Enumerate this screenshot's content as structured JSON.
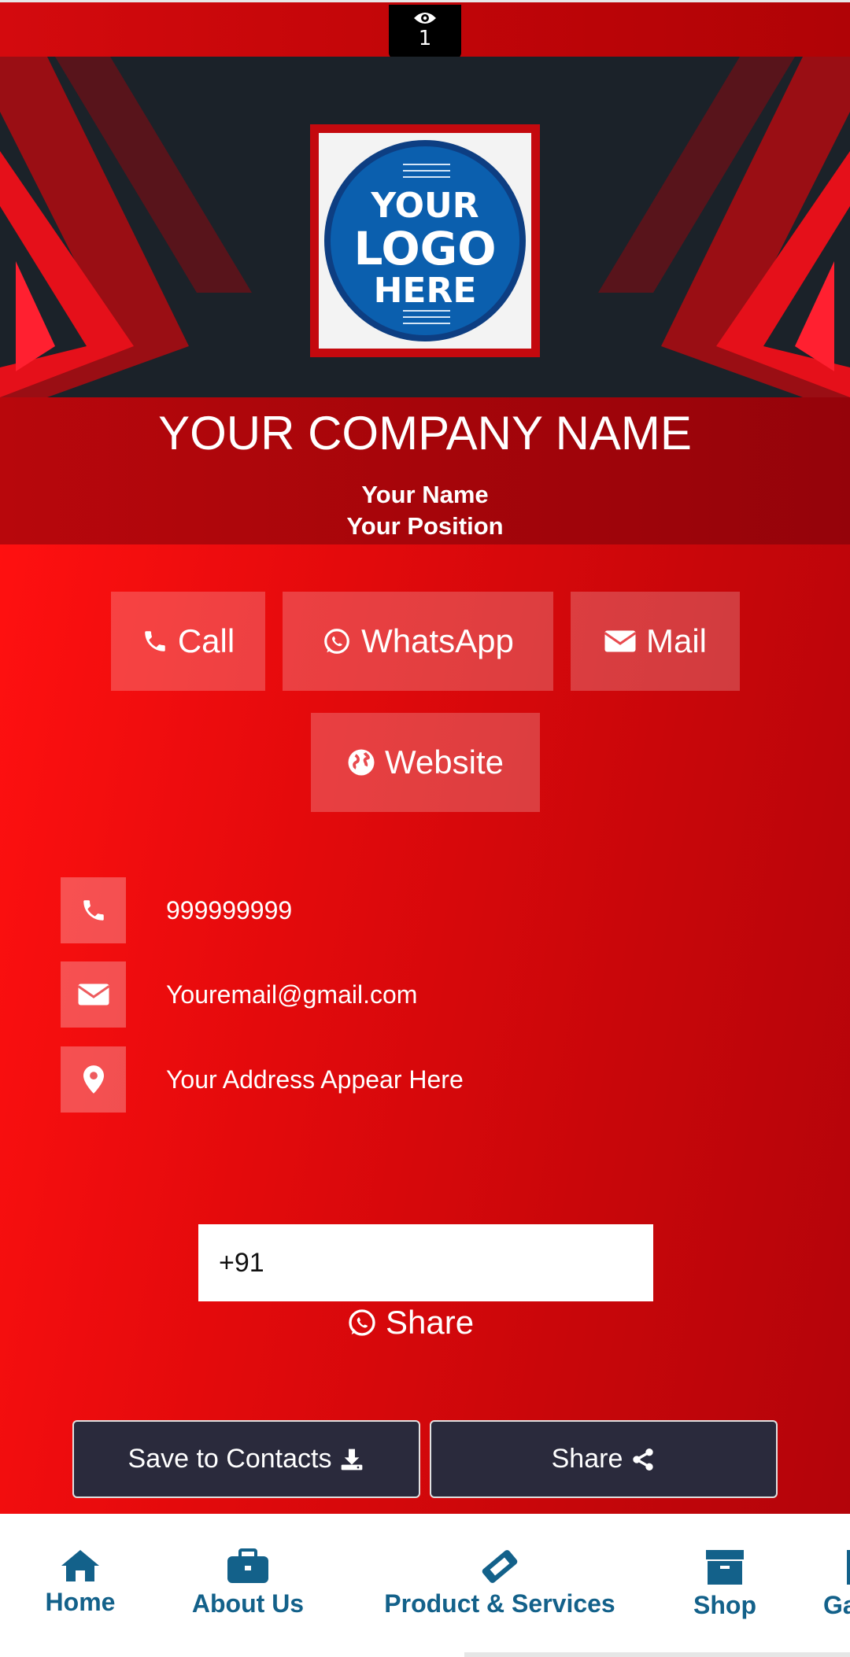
{
  "view_counter": {
    "icon": "eye-icon",
    "count": "1"
  },
  "logo": {
    "line1": "YOUR",
    "line2": "LOGO",
    "line3": "HERE"
  },
  "company": {
    "name": "YOUR COMPANY NAME",
    "person_name": "Your Name",
    "position": "Your Position"
  },
  "actions": [
    {
      "label": "Call",
      "icon": "phone-icon"
    },
    {
      "label": "WhatsApp",
      "icon": "whatsapp-icon"
    },
    {
      "label": "Mail",
      "icon": "envelope-icon"
    },
    {
      "label": "Website",
      "icon": "globe-icon"
    }
  ],
  "contact": {
    "phone": "999999999",
    "email": "Youremail@gmail.com",
    "address": "Your Address Appear Here"
  },
  "share_form": {
    "phone_value": "+91",
    "share_label": "Share"
  },
  "buttons": {
    "save_contacts": "Save to Contacts",
    "share": "Share"
  },
  "nav": [
    {
      "label": "Home",
      "icon": "home-icon"
    },
    {
      "label": "About Us",
      "icon": "briefcase-icon"
    },
    {
      "label": "Product & Services",
      "icon": "ticket-icon"
    },
    {
      "label": "Shop",
      "icon": "archive-box-icon"
    },
    {
      "label": "Ga",
      "icon": "gallery-icon"
    }
  ],
  "colors": {
    "accent_red": "#e30a0c",
    "dark": "#1b2229",
    "nav_text": "#13618a",
    "button_dark": "#2a2a3c"
  }
}
